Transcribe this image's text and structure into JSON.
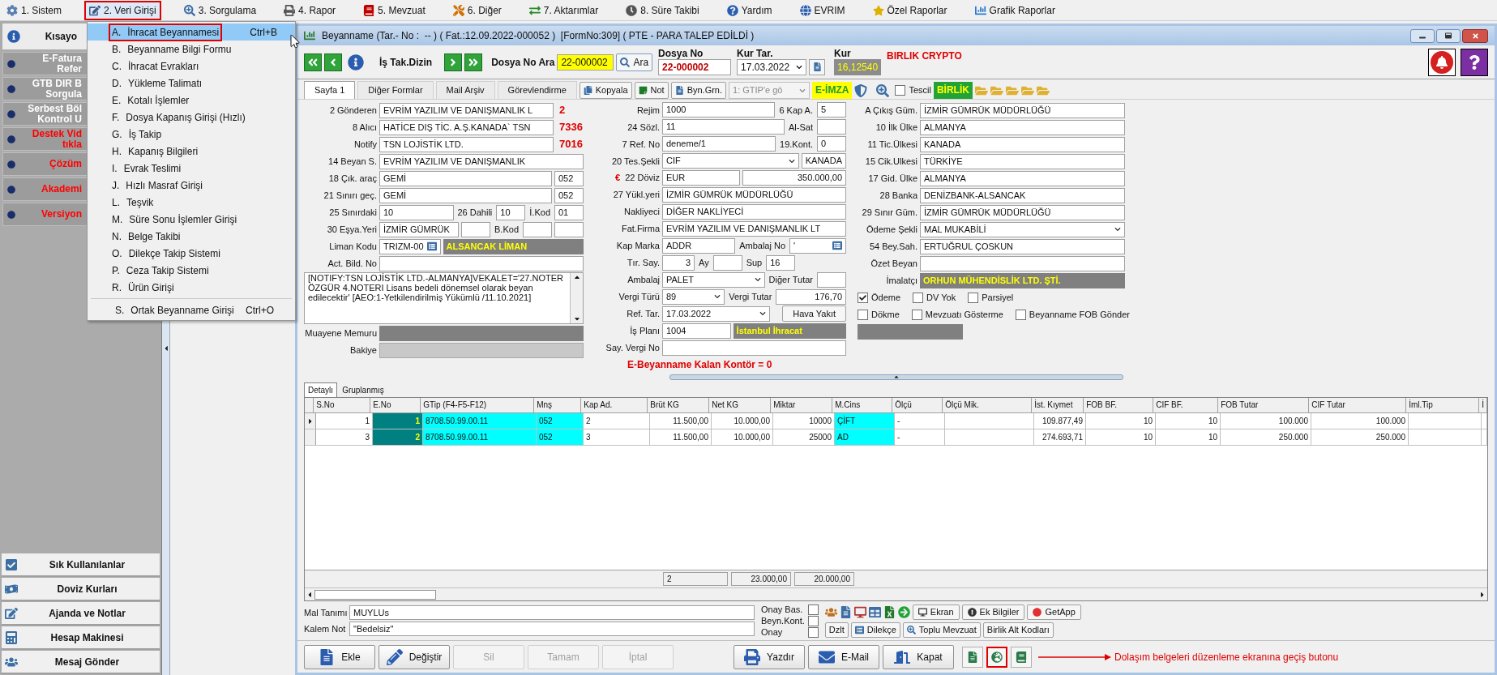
{
  "menubar": [
    {
      "label": "1. Sistem",
      "selected": false
    },
    {
      "label": "2. Veri Girişi",
      "selected": true
    },
    {
      "label": "3. Sorgulama",
      "selected": false
    },
    {
      "label": "4. Rapor",
      "selected": false
    },
    {
      "label": "5. Mevzuat",
      "selected": false
    },
    {
      "label": "6. Diğer",
      "selected": false
    },
    {
      "label": "7. Aktarımlar",
      "selected": false
    },
    {
      "label": "8. Süre Takibi",
      "selected": false
    },
    {
      "label": "Yardım",
      "selected": false
    },
    {
      "label": "EVRIM",
      "selected": false
    },
    {
      "label": "Özel Raporlar",
      "selected": false
    },
    {
      "label": "Grafik Raporlar",
      "selected": false
    }
  ],
  "dropdown": {
    "sections": [
      [
        {
          "letter": "A.",
          "label": "İhracat Beyannamesi",
          "shortcut": "Ctrl+B",
          "selected": true
        },
        {
          "letter": "B.",
          "label": "Beyanname Bilgi Formu",
          "selected": false
        },
        {
          "letter": "C.",
          "label": "İhracat Evrakları",
          "selected": false
        },
        {
          "letter": "D.",
          "label": "Yükleme Talimatı",
          "selected": false
        },
        {
          "letter": "E.",
          "label": "Kotalı İşlemler",
          "selected": false
        },
        {
          "letter": "F.",
          "label": "Dosya Kapanış Girişi (Hızlı)",
          "selected": false
        },
        {
          "letter": "G.",
          "label": "İş Takip",
          "selected": false
        },
        {
          "letter": "H.",
          "label": "Kapanış Bilgileri",
          "selected": false
        },
        {
          "letter": "I.",
          "label": "Evrak Teslimi",
          "selected": false
        },
        {
          "letter": "J.",
          "label": "Hızlı Masraf Girişi",
          "selected": false
        },
        {
          "letter": "L.",
          "label": "Teşvik",
          "selected": false
        },
        {
          "letter": "M.",
          "label": "Süre Sonu İşlemler Girişi",
          "selected": false
        },
        {
          "letter": "N.",
          "label": "Belge Takibi",
          "selected": false
        },
        {
          "letter": "O.",
          "label": "Dilekçe Takip Sistemi",
          "selected": false
        },
        {
          "letter": "P.",
          "label": "Ceza Takip Sistemi",
          "selected": false
        },
        {
          "letter": "R.",
          "label": "Ürün Girişi",
          "selected": false
        }
      ],
      [
        {
          "letter": "S.",
          "label": "Ortak Beyanname Girişi",
          "shortcut": "Ctrl+O",
          "selected": false
        }
      ]
    ]
  },
  "sidebar": {
    "header": "Kısayo",
    "items": [
      {
        "label": "E-Fatura Refer",
        "color": "#ffffff"
      },
      {
        "label": "GTB DIR B Sorgula",
        "color": "#ffffff"
      },
      {
        "label": "Serbest Böl Kontrol U",
        "color": "#ffffff"
      },
      {
        "label": "Destek Vid tıkla",
        "color": "#ff0000"
      },
      {
        "label": "Çözüm",
        "color": "#ff0000"
      },
      {
        "label": "Akademi",
        "color": "#ff0000"
      },
      {
        "label": "Versiyon",
        "color": "#ff0000"
      }
    ],
    "bottom_buttons": [
      "Sık Kullanılanlar",
      "Doviz Kurları",
      "Ajanda ve Notlar",
      "Hesap Makinesi",
      "Mesaj Gönder"
    ]
  },
  "window": {
    "title": "Beyanname (Tar.- No :  -- ) ( Fat.:12.09.2022-000052 )  [FormNo:309] ( PTE - PARA TALEP EDİLDİ )"
  },
  "toolbar": {
    "nav_label": "İş Tak.Dizin",
    "search_label": "Dosya No Ara",
    "search_value": "22-000002",
    "search_button": "Ara",
    "dosya_no": {
      "label": "Dosya No",
      "value": "22-000002"
    },
    "kur_tar": {
      "label": "Kur Tar.",
      "value": "17.03.2022"
    },
    "kur": {
      "label": "Kur",
      "value": "16,12540"
    },
    "company": "BIRLIK CRYPTO"
  },
  "form_tabs": [
    {
      "label": "Sayfa 1",
      "selected": true
    },
    {
      "label": "Diğer Formlar",
      "selected": false
    },
    {
      "label": "Mail Arşiv",
      "selected": false
    },
    {
      "label": "Görevlendirme",
      "selected": false
    }
  ],
  "form_toolbar": {
    "copy_button": "Kopyala",
    "note_button": "Not",
    "byn_button": "Byn.Grn.",
    "gtip_combo": "1: GTIP'e gö",
    "esign_badge": "E-İMZA",
    "tescil": {
      "label": "Tescil",
      "checked": false
    },
    "birlik_badge": "BİRLİK"
  },
  "form": {
    "columns": [
      [
        [
          {
            "kind": "label",
            "text": "2 Gönderen"
          },
          {
            "kind": "field",
            "value": "EVRİM YAZILIM VE DANIŞMANLIK L"
          },
          {
            "kind": "code",
            "text": "2"
          }
        ],
        [
          {
            "kind": "label",
            "text": "8 Alıcı"
          },
          {
            "kind": "field",
            "value": "HATİCE DIŞ TİC. A.Ş.KANADA` TSN"
          },
          {
            "kind": "code",
            "text": "7336"
          }
        ],
        [
          {
            "kind": "label",
            "text": "Notify"
          },
          {
            "kind": "field",
            "value": "TSN LOJİSTİK LTD."
          },
          {
            "kind": "code",
            "text": "7016"
          }
        ],
        [
          {
            "kind": "label",
            "text": "14 Beyan S."
          },
          {
            "kind": "field",
            "value": "EVRİM YAZILIM VE DANIŞMANLIK"
          }
        ],
        [
          {
            "kind": "label",
            "text": "18 Çık. araç"
          },
          {
            "kind": "field",
            "value": "GEMİ"
          },
          {
            "kind": "field",
            "value": "052"
          }
        ],
        [
          {
            "kind": "label",
            "text": "21 Sınırı geç."
          },
          {
            "kind": "field",
            "value": "GEMİ"
          },
          {
            "kind": "field",
            "value": "052"
          }
        ],
        [
          {
            "kind": "label",
            "text": "25 Sınırdaki"
          },
          {
            "kind": "field",
            "value": "10"
          },
          {
            "kind": "label",
            "text": "26 Dahili"
          },
          {
            "kind": "field",
            "value": "10"
          },
          {
            "kind": "label",
            "text": "İ.Kod"
          },
          {
            "kind": "field",
            "value": "01"
          }
        ],
        [
          {
            "kind": "label",
            "text": "30 Eşya.Yeri"
          },
          {
            "kind": "field",
            "value": "İZMİR GÜMRÜK"
          },
          {
            "kind": "field"
          },
          {
            "kind": "label",
            "text": "B.Kod"
          },
          {
            "kind": "field"
          },
          {
            "kind": "field"
          }
        ],
        [
          {
            "kind": "label",
            "text": "Liman Kodu"
          },
          {
            "kind": "lookup",
            "value": "TRIZM-00"
          },
          {
            "kind": "display",
            "value": "ALSANCAK LİMAN"
          }
        ],
        [
          {
            "kind": "label",
            "text": "Act. Bild. No"
          },
          {
            "kind": "field"
          }
        ],
        [
          {
            "kind": "memo",
            "value": "[NOTIFY:TSN LOJİSTİK LTD.-ALMANYA]VEKALET='27.NOTER ÖZGÜR 4.NOTERI Lisans bedeli dönemsel olarak beyan edilecektir' [AEO:1-Yetkilendirilmiş Yükümlü /11.10.2021]"
          }
        ],
        [
          {
            "kind": "label",
            "text": "Muayene Memuru"
          },
          {
            "kind": "display"
          }
        ],
        [
          {
            "kind": "label",
            "text": "Bakiye"
          },
          {
            "kind": "readonly"
          }
        ]
      ],
      [
        [
          {
            "kind": "label",
            "text": "Rejim"
          },
          {
            "kind": "field",
            "value": "1000"
          },
          {
            "kind": "label",
            "text": "6 Kap A."
          },
          {
            "kind": "field",
            "value": "5"
          }
        ],
        [
          {
            "kind": "label",
            "text": "24 Sözl."
          },
          {
            "kind": "field",
            "value": "11"
          },
          {
            "kind": "label",
            "text": "Al-Sat"
          },
          {
            "kind": "field"
          }
        ],
        [
          {
            "kind": "label",
            "text": "7 Ref. No"
          },
          {
            "kind": "field",
            "value": "deneme/1"
          },
          {
            "kind": "label",
            "text": "19.Kont."
          },
          {
            "kind": "field",
            "value": "0"
          }
        ],
        [
          {
            "kind": "label",
            "text": "20 Tes.Şekli"
          },
          {
            "kind": "combo",
            "value": "CIF"
          },
          {
            "kind": "field",
            "value": "KANADA"
          }
        ],
        [
          {
            "kind": "label",
            "text": "22 Döviz",
            "symbol": "€"
          },
          {
            "kind": "field",
            "value": "EUR"
          },
          {
            "kind": "number",
            "value": "350.000,00"
          }
        ],
        [
          {
            "kind": "label",
            "text": "27 Yükl.yeri"
          },
          {
            "kind": "field",
            "value": "İZMİR GÜMRÜK MÜDÜRLÜĞÜ"
          }
        ],
        [
          {
            "kind": "label",
            "text": "Nakliyeci"
          },
          {
            "kind": "field",
            "value": "DİĞER NAKLİYECİ"
          }
        ],
        [
          {
            "kind": "label",
            "text": "Fat.Firma"
          },
          {
            "kind": "field",
            "value": "EVRİM YAZILIM VE DANIŞMANLIK LT"
          }
        ],
        [
          {
            "kind": "label",
            "text": "Kap Marka"
          },
          {
            "kind": "field",
            "value": "ADDR"
          },
          {
            "kind": "label",
            "text": "Ambalaj No"
          },
          {
            "kind": "lookup",
            "value": "'"
          }
        ],
        [
          {
            "kind": "label",
            "text": "Tır. Say."
          },
          {
            "kind": "number",
            "value": "3"
          },
          {
            "kind": "label",
            "text": "Ay"
          },
          {
            "kind": "field"
          },
          {
            "kind": "label",
            "text": "Sup"
          },
          {
            "kind": "field",
            "value": "16"
          }
        ],
        [
          {
            "kind": "label",
            "text": "Ambalaj"
          },
          {
            "kind": "combo",
            "value": "PALET"
          },
          {
            "kind": "label",
            "text": "Diğer Tutar"
          },
          {
            "kind": "field"
          }
        ],
        [
          {
            "kind": "label",
            "text": "Vergi Türü"
          },
          {
            "kind": "combo",
            "value": "89"
          },
          {
            "kind": "label",
            "text": "Vergi Tutar"
          },
          {
            "kind": "number",
            "value": "176,70"
          }
        ],
        [
          {
            "kind": "label",
            "text": "Ref. Tar."
          },
          {
            "kind": "combo",
            "value": "17.03.2022"
          },
          {
            "kind": "button",
            "text": "Hava Yakıt"
          }
        ],
        [
          {
            "kind": "label",
            "text": "İş Planı"
          },
          {
            "kind": "field",
            "value": "1004"
          },
          {
            "kind": "display",
            "value": "İstanbul İhracat"
          }
        ],
        [
          {
            "kind": "label",
            "text": "Say. Vergi No"
          },
          {
            "kind": "field"
          }
        ],
        [
          {
            "kind": "note",
            "text": "E-Beyanname Kalan Kontör = 0"
          }
        ]
      ],
      [
        [
          {
            "kind": "label",
            "text": "A Çıkış Güm."
          },
          {
            "kind": "field",
            "value": "İZMİR GÜMRÜK MÜDÜRLÜĞÜ"
          }
        ],
        [
          {
            "kind": "label",
            "text": "10 İlk Ülke"
          },
          {
            "kind": "field",
            "value": "ALMANYA"
          }
        ],
        [
          {
            "kind": "label",
            "text": "11 Tic.Ülkesi"
          },
          {
            "kind": "field",
            "value": "KANADA"
          }
        ],
        [
          {
            "kind": "label",
            "text": "15 Cik.Ulkesi"
          },
          {
            "kind": "field",
            "value": "TÜRKİYE"
          }
        ],
        [
          {
            "kind": "label",
            "text": "17 Gid. Ülke"
          },
          {
            "kind": "field",
            "value": "ALMANYA"
          }
        ],
        [
          {
            "kind": "label",
            "text": "28 Banka"
          },
          {
            "kind": "field",
            "value": "DENİZBANK-ALSANCAK"
          }
        ],
        [
          {
            "kind": "label",
            "text": "29 Sınır Güm."
          },
          {
            "kind": "field",
            "value": "İZMİR GÜMRÜK MÜDÜRLÜĞÜ"
          }
        ],
        [
          {
            "kind": "label",
            "text": "Ödeme Şekli"
          },
          {
            "kind": "combo",
            "value": "MAL MUKABİLİ"
          }
        ],
        [
          {
            "kind": "label",
            "text": "54 Bey.Sah."
          },
          {
            "kind": "field",
            "value": "ERTUĞRUL ÇOSKUN"
          }
        ],
        [
          {
            "kind": "label",
            "text": "Özet Beyan"
          },
          {
            "kind": "field"
          }
        ],
        [
          {
            "kind": "label",
            "text": "İmalatçı"
          },
          {
            "kind": "display",
            "value": "ORHUN MÜHENDİSLİK LTD. ŞTİ."
          }
        ],
        [
          {
            "kind": "checkbox",
            "text": "Ödeme",
            "checked": true
          },
          {
            "kind": "checkbox",
            "text": "DV Yok",
            "checked": false
          },
          {
            "kind": "checkbox",
            "text": "Parsiyel",
            "checked": false
          }
        ],
        [
          {
            "kind": "checkbox",
            "text": "Dökme",
            "checked": false
          },
          {
            "kind": "checkbox",
            "text": "Mevzuatı Gösterme",
            "checked": false
          },
          {
            "kind": "checkbox",
            "text": "Beyanname FOB Gönder",
            "checked": false
          }
        ],
        [
          {
            "kind": "display"
          }
        ]
      ]
    ]
  },
  "grid": {
    "tabs": [
      {
        "label": "Detaylı",
        "selected": true
      },
      {
        "label": "Gruplanmış",
        "selected": false
      }
    ],
    "columns": [
      "S.No",
      "E.No",
      "GTip (F4-F5-F12)",
      "Mnş",
      "Kap Ad.",
      "Brüt KG",
      "Net KG",
      "Miktar",
      "M.Cins",
      "Ölçü",
      "Ölçü Mik.",
      "İst. Kıymet",
      "FOB BF.",
      "CIF BF.",
      "FOB Tutar",
      "CIF Tutar",
      "İml.Tip",
      "İ"
    ],
    "rows": [
      {
        "selected": true,
        "cells": [
          "1",
          "1",
          "8708.50.99.00.11",
          "052",
          "2",
          "11.500,00",
          "10.000,00",
          "10000",
          "ÇİFT",
          "-",
          "",
          "109.877,49",
          "10",
          "10",
          "100.000",
          "100.000",
          "",
          ""
        ]
      },
      {
        "selected": false,
        "cells": [
          "3",
          "2",
          "8708.50.99.00.11",
          "052",
          "3",
          "11.500,00",
          "10.000,00",
          "25000",
          "AD",
          "-",
          "",
          "274.693,71",
          "10",
          "10",
          "250.000",
          "250.000",
          "",
          ""
        ]
      }
    ],
    "totals": [
      "2",
      "23.000,00",
      "20.000,00"
    ]
  },
  "details": {
    "mal_tanimi": {
      "label": "Mal Tanımı",
      "value": "MUYLUs"
    },
    "kalem_not": {
      "label": "Kalem Not",
      "value": "\"Bedelsiz\""
    },
    "approvals": [
      {
        "label": "Onay Bas.",
        "checked": false
      },
      {
        "label": "Beyn.Kont.",
        "checked": false
      },
      {
        "label": "Onay",
        "checked": false
      }
    ],
    "tool_buttons": [
      "Ekran",
      "Ek Bilgiler",
      "GetApp"
    ],
    "tool_buttons_2": [
      "Dzlt",
      "Dilekçe",
      "Toplu Mevzuat",
      "Birlik Alt Kodları"
    ]
  },
  "actions": [
    {
      "label": "Ekle",
      "disabled": false
    },
    {
      "label": "Değiştir",
      "disabled": false
    },
    {
      "label": "Sil",
      "disabled": true
    },
    {
      "label": "Tamam",
      "disabled": true
    },
    {
      "label": "İptal",
      "disabled": true
    },
    {
      "label": "Yazdır",
      "disabled": false
    },
    {
      "label": "E-Mail",
      "disabled": false
    },
    {
      "label": "Kapat",
      "disabled": false
    }
  ],
  "icon_buttons": [
    {
      "highlighted": false
    },
    {
      "highlighted": true
    },
    {
      "highlighted": false
    }
  ],
  "annotation": "Dolaşım belgeleri düzenleme ekranına geçiş butonu"
}
